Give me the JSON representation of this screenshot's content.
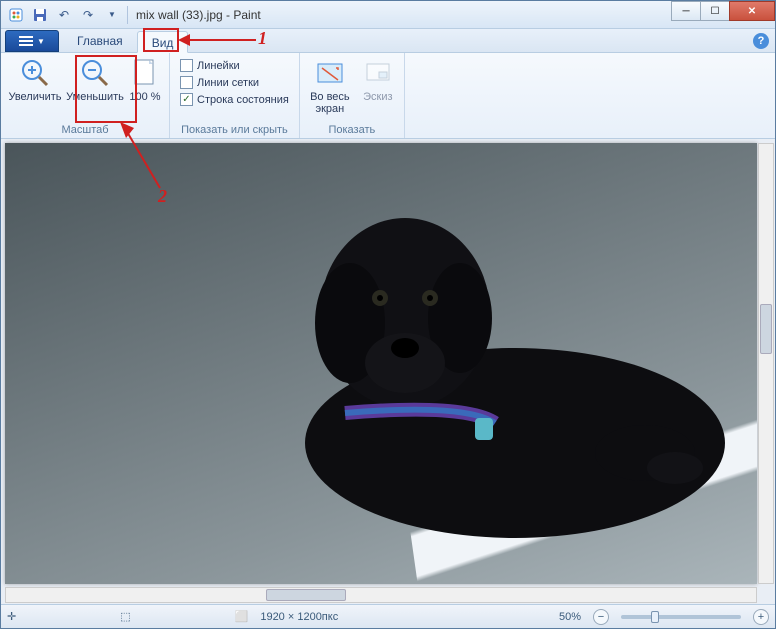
{
  "titlebar": {
    "filename": "mix wall (33).jpg - Paint"
  },
  "tabs": {
    "home": "Главная",
    "view": "Вид"
  },
  "ribbon": {
    "zoom_group": "Масштаб",
    "zoomin": "Увеличить",
    "zoomout": "Уменьшить",
    "pct100": "100 %",
    "show_group": "Показать или скрыть",
    "rulers": "Линейки",
    "gridlines": "Линии сетки",
    "statusbar": "Строка состояния",
    "display_group": "Показать",
    "fullscreen": "Во весь экран",
    "thumbnail": "Эскиз"
  },
  "status": {
    "dimensions": "1920 × 1200пкс",
    "zoom": "50%"
  },
  "annotations": {
    "n1": "1",
    "n2": "2"
  }
}
